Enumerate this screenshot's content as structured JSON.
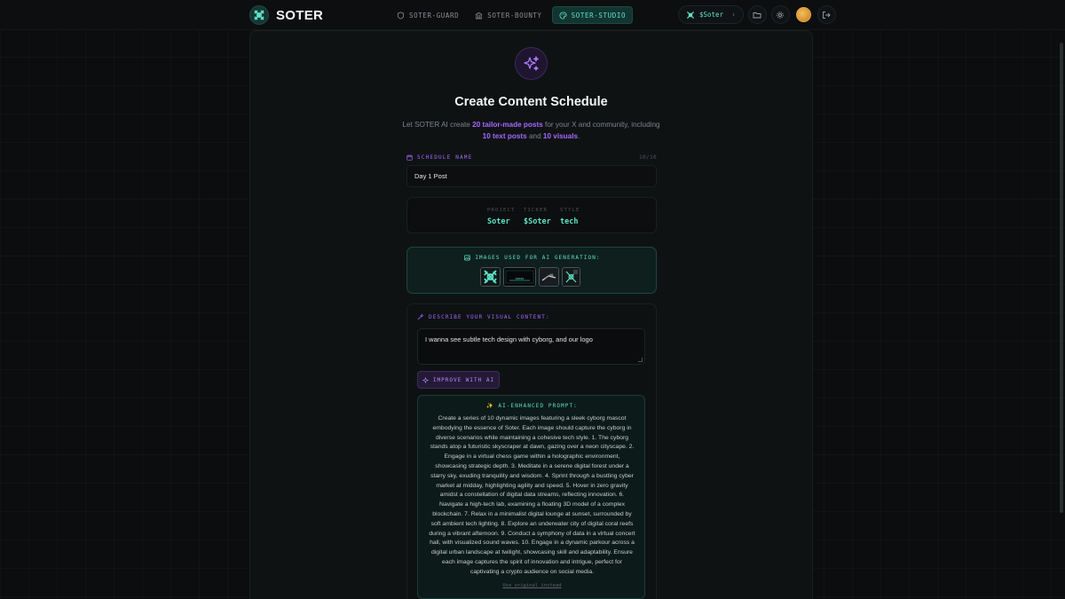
{
  "header": {
    "brand": "SOTER",
    "nav": [
      {
        "label": "SOTER-GUARD",
        "icon": "shield-icon",
        "active": false
      },
      {
        "label": "SOTER-BOUNTY",
        "icon": "building-icon",
        "active": false
      },
      {
        "label": "SOTER-STUDIO",
        "icon": "palette-icon",
        "active": true
      }
    ],
    "token": "$Soter",
    "tools": [
      "folder-icon",
      "gear-icon",
      "avatar",
      "logout-icon"
    ]
  },
  "page": {
    "title": "Create Content Schedule",
    "subtitle": {
      "p1": "Let SOTER AI create ",
      "h1": "20 tailor-made posts",
      "p2": " for your X and community, including ",
      "h2": "10 text posts",
      "p3": " and ",
      "h3": "10 visuals",
      "p4": "."
    },
    "accent_purple": "#a468ff",
    "accent_teal": "#5ee3c8"
  },
  "schedule": {
    "label": "SCHEDULE NAME",
    "count": "10/10",
    "value": "Day 1 Post"
  },
  "meta": {
    "project_label": "PROJECT",
    "project": "Soter",
    "ticker_label": "TICKER",
    "ticker": "$Soter",
    "style_label": "STYLE",
    "style": "tech"
  },
  "images": {
    "label": "IMAGES USED FOR AI GENERATION:"
  },
  "describe": {
    "label": "DESCRIBE YOUR VISUAL CONTENT:",
    "value": "I wanna see subtle tech design with cyborg, and our logo",
    "improve_label": "IMPROVE WITH AI"
  },
  "enhanced": {
    "label": "✨ AI-ENHANCED PROMPT:",
    "text": "Create a series of 10 dynamic images featuring a sleek cyborg mascot embodying the essence of Soter. Each image should capture the cyborg in diverse scenarios while maintaining a cohesive tech style. 1. The cyborg stands atop a futuristic skyscraper at dawn, gazing over a neon cityscape. 2. Engage in a virtual chess game within a holographic environment, showcasing strategic depth. 3. Meditate in a serene digital forest under a starry sky, exuding tranquility and wisdom. 4. Sprint through a bustling cyber market at midday, highlighting agility and speed. 5. Hover in zero gravity amidst a constellation of digital data streams, reflecting innovation. 6. Navigate a high-tech lab, examining a floating 3D model of a complex blockchain. 7. Relax in a minimalist digital lounge at sunset, surrounded by soft ambient tech lighting. 8. Explore an underwater city of digital coral reefs during a vibrant afternoon. 9. Conduct a symphony of data in a virtual concert hall, with visualized sound waves. 10. Engage in a dynamic parkour across a digital urban landscape at twilight, showcasing skill and adaptability. Ensure each image captures the spirit of innovation and intrigue, perfect for captivating a crypto audience on social media.",
    "use_original": "Use original instead"
  }
}
